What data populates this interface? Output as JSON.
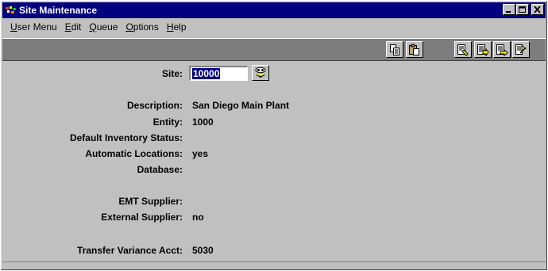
{
  "window": {
    "title": "Site Maintenance",
    "controls": {
      "minimize": "minimize",
      "maximize": "maximize",
      "close": "close"
    }
  },
  "menu": [
    {
      "label": "User Menu",
      "underline": "U",
      "rest": "ser Menu"
    },
    {
      "label": "Edit",
      "underline": "E",
      "rest": "dit"
    },
    {
      "label": "Queue",
      "underline": "Q",
      "rest": "ueue"
    },
    {
      "label": "Options",
      "underline": "O",
      "rest": "ptions"
    },
    {
      "label": "Help",
      "underline": "H",
      "rest": "elp"
    }
  ],
  "toolbar": {
    "icons": [
      "copy-icon",
      "paste-icon",
      "look-up-icon",
      "browse-icon",
      "go-to-icon",
      "next-icon"
    ]
  },
  "form": {
    "site": {
      "label": "Site:",
      "value": "10000"
    },
    "description": {
      "label": "Description:",
      "value": "San Diego Main Plant"
    },
    "entity": {
      "label": "Entity:",
      "value": "1000"
    },
    "default_inventory_status": {
      "label": "Default Inventory Status:",
      "value": ""
    },
    "automatic_locations": {
      "label": "Automatic Locations:",
      "value": "yes"
    },
    "database": {
      "label": "Database:",
      "value": ""
    },
    "emt_supplier": {
      "label": "EMT Supplier:",
      "value": ""
    },
    "external_supplier": {
      "label": "External Supplier:",
      "value": "no"
    },
    "transfer_variance_acct": {
      "label": "Transfer Variance Acct:",
      "value": "5030"
    }
  },
  "colors": {
    "title_bar": "#000080",
    "window_face": "#c0c0c0",
    "toolbar_band": "#7d7d7d",
    "selection": "#000080"
  }
}
